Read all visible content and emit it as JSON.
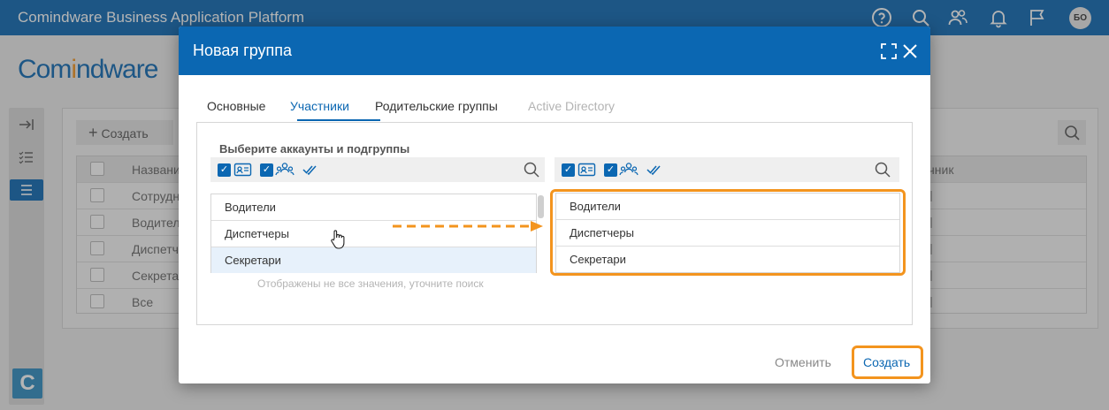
{
  "app": {
    "title": "Comindware Business Application Platform",
    "logo_parts": [
      "Com",
      "i",
      "ndware"
    ],
    "user_initials": "БО",
    "brand_letter": "C",
    "toolbar_icons": [
      "help-icon",
      "search-icon",
      "users-icon",
      "bell-icon",
      "flag-icon"
    ]
  },
  "background": {
    "create_label": "Создать",
    "grid_header": "Названи",
    "grid_header_right": "очник",
    "rows": [
      "Сотрудн",
      "Водител",
      "Диспетч",
      "Секретар",
      "Все"
    ]
  },
  "dialog": {
    "title": "Новая группа",
    "tabs": [
      {
        "label": "Основные",
        "state": "normal"
      },
      {
        "label": "Участники",
        "state": "active"
      },
      {
        "label": "Родительские группы",
        "state": "normal"
      },
      {
        "label": "Active Directory",
        "state": "disabled"
      }
    ],
    "picker_label": "Выберите аккаунты и подгруппы",
    "available": [
      "Водители",
      "Диспетчеры",
      "Секретари"
    ],
    "selected_available_index": 2,
    "hint": "Отображены не все значения, уточните поиск",
    "selected": [
      "Водители",
      "Диспетчеры",
      "Секретари"
    ],
    "cancel_label": "Отменить",
    "create_label": "Создать"
  },
  "colors": {
    "primary": "#0b67b2",
    "accent": "#f3941e",
    "selected_row": "#e7f1fb"
  }
}
